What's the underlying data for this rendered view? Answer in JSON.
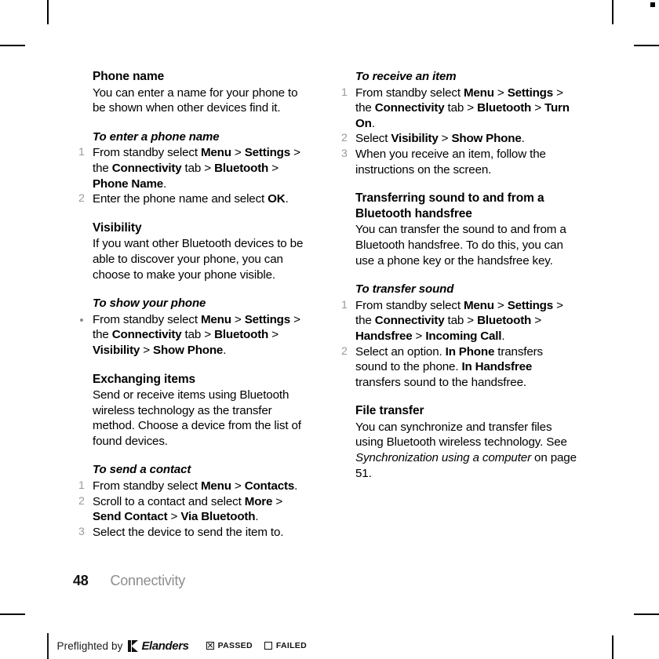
{
  "document": {
    "page_number": "48",
    "section_label": "Connectivity"
  },
  "left_column": {
    "phone_name": {
      "heading": "Phone name",
      "body": "You can enter a name for your phone to be shown when other devices find it."
    },
    "to_enter_a_phone_name": {
      "heading": "To enter a phone name",
      "steps": [
        {
          "number": "1",
          "segments": [
            {
              "text": "From standby select ",
              "style": "normal"
            },
            {
              "text": "Menu",
              "style": "bold"
            },
            {
              "text": " > ",
              "style": "normal"
            },
            {
              "text": "Settings",
              "style": "bold"
            },
            {
              "text": " > the ",
              "style": "normal"
            },
            {
              "text": "Connectivity",
              "style": "bold"
            },
            {
              "text": " tab > ",
              "style": "normal"
            },
            {
              "text": "Bluetooth",
              "style": "bold"
            },
            {
              "text": " > ",
              "style": "normal"
            },
            {
              "text": "Phone Name",
              "style": "bold"
            },
            {
              "text": ".",
              "style": "normal"
            }
          ]
        },
        {
          "number": "2",
          "segments": [
            {
              "text": "Enter the phone name and select ",
              "style": "normal"
            },
            {
              "text": "OK",
              "style": "bold"
            },
            {
              "text": ".",
              "style": "normal"
            }
          ]
        }
      ]
    },
    "visibility": {
      "heading": "Visibility",
      "body": "If you want other Bluetooth devices to be able to discover your phone, you can choose to make your phone visible."
    },
    "to_show_your_phone": {
      "heading": "To show your phone",
      "steps": [
        {
          "marker": "bullet",
          "segments": [
            {
              "text": "From standby select ",
              "style": "normal"
            },
            {
              "text": "Menu",
              "style": "bold"
            },
            {
              "text": " > ",
              "style": "normal"
            },
            {
              "text": "Settings",
              "style": "bold"
            },
            {
              "text": " > the ",
              "style": "normal"
            },
            {
              "text": "Connectivity",
              "style": "bold"
            },
            {
              "text": " tab > ",
              "style": "normal"
            },
            {
              "text": "Bluetooth",
              "style": "bold"
            },
            {
              "text": " > ",
              "style": "normal"
            },
            {
              "text": "Visibility",
              "style": "bold"
            },
            {
              "text": " > ",
              "style": "normal"
            },
            {
              "text": "Show Phone",
              "style": "bold"
            },
            {
              "text": ".",
              "style": "normal"
            }
          ]
        }
      ]
    },
    "exchanging_items": {
      "heading": "Exchanging items",
      "body": "Send or receive items using Bluetooth wireless technology as the transfer method. Choose a device from the list of found devices."
    },
    "to_send_a_contact": {
      "heading": "To send a contact",
      "steps": [
        {
          "number": "1",
          "segments": [
            {
              "text": "From standby select ",
              "style": "normal"
            },
            {
              "text": "Menu",
              "style": "bold"
            },
            {
              "text": " > ",
              "style": "normal"
            },
            {
              "text": "Contacts",
              "style": "bold"
            },
            {
              "text": ".",
              "style": "normal"
            }
          ]
        },
        {
          "number": "2",
          "segments": [
            {
              "text": "Scroll to a contact and select ",
              "style": "normal"
            },
            {
              "text": "More",
              "style": "bold"
            },
            {
              "text": " > ",
              "style": "normal"
            },
            {
              "text": "Send Contact",
              "style": "bold"
            },
            {
              "text": " > ",
              "style": "normal"
            },
            {
              "text": "Via Bluetooth",
              "style": "bold"
            },
            {
              "text": ".",
              "style": "normal"
            }
          ]
        },
        {
          "number": "3",
          "segments": [
            {
              "text": "Select the device to send the item to.",
              "style": "normal"
            }
          ]
        }
      ]
    }
  },
  "right_column": {
    "to_receive_an_item": {
      "heading": "To receive an item",
      "steps": [
        {
          "number": "1",
          "segments": [
            {
              "text": "From standby select ",
              "style": "normal"
            },
            {
              "text": "Menu",
              "style": "bold"
            },
            {
              "text": " > ",
              "style": "normal"
            },
            {
              "text": "Settings",
              "style": "bold"
            },
            {
              "text": " > the ",
              "style": "normal"
            },
            {
              "text": "Connectivity",
              "style": "bold"
            },
            {
              "text": " tab > ",
              "style": "normal"
            },
            {
              "text": "Bluetooth",
              "style": "bold"
            },
            {
              "text": " > ",
              "style": "normal"
            },
            {
              "text": "Turn On",
              "style": "bold"
            },
            {
              "text": ".",
              "style": "normal"
            }
          ]
        },
        {
          "number": "2",
          "segments": [
            {
              "text": "Select ",
              "style": "normal"
            },
            {
              "text": "Visibility",
              "style": "bold"
            },
            {
              "text": " > ",
              "style": "normal"
            },
            {
              "text": "Show Phone",
              "style": "bold"
            },
            {
              "text": ".",
              "style": "normal"
            }
          ]
        },
        {
          "number": "3",
          "segments": [
            {
              "text": "When you receive an item, follow the instructions on the screen.",
              "style": "normal"
            }
          ]
        }
      ]
    },
    "transferring_sound": {
      "heading": "Transferring sound to and from a Bluetooth handsfree",
      "body": "You can transfer the sound to and from a Bluetooth handsfree. To do this, you can use a phone key or the handsfree key."
    },
    "to_transfer_sound": {
      "heading": "To transfer sound",
      "steps": [
        {
          "number": "1",
          "segments": [
            {
              "text": "From standby select ",
              "style": "normal"
            },
            {
              "text": "Menu",
              "style": "bold"
            },
            {
              "text": " > ",
              "style": "normal"
            },
            {
              "text": "Settings",
              "style": "bold"
            },
            {
              "text": " > the ",
              "style": "normal"
            },
            {
              "text": "Connectivity",
              "style": "bold"
            },
            {
              "text": " tab > ",
              "style": "normal"
            },
            {
              "text": "Bluetooth",
              "style": "bold"
            },
            {
              "text": " > ",
              "style": "normal"
            },
            {
              "text": "Handsfree",
              "style": "bold"
            },
            {
              "text": " > ",
              "style": "normal"
            },
            {
              "text": "Incoming Call",
              "style": "bold"
            },
            {
              "text": ".",
              "style": "normal"
            }
          ]
        },
        {
          "number": "2",
          "segments": [
            {
              "text": "Select an option. ",
              "style": "normal"
            },
            {
              "text": "In Phone",
              "style": "bold"
            },
            {
              "text": " transfers sound to the phone. ",
              "style": "normal"
            },
            {
              "text": "In Handsfree",
              "style": "bold"
            },
            {
              "text": " transfers sound to the handsfree.",
              "style": "normal"
            }
          ]
        }
      ]
    },
    "file_transfer": {
      "heading": "File transfer",
      "body_segments": [
        {
          "text": "You can synchronize and transfer files using Bluetooth wireless technology. See ",
          "style": "normal"
        },
        {
          "text": "Synchronization using a computer",
          "style": "italic"
        },
        {
          "text": " on page 51.",
          "style": "normal"
        }
      ]
    }
  },
  "preflight_bar": {
    "label": "Preflighted by",
    "brand": "Elanders",
    "passed_label": "PASSED",
    "failed_label": "FAILED",
    "passed_checked": true,
    "failed_checked": false
  },
  "colors": {
    "text": "#000000",
    "step_number": "#9a9a9a",
    "folio_label": "#8e8e8e",
    "background": "#ffffff"
  }
}
